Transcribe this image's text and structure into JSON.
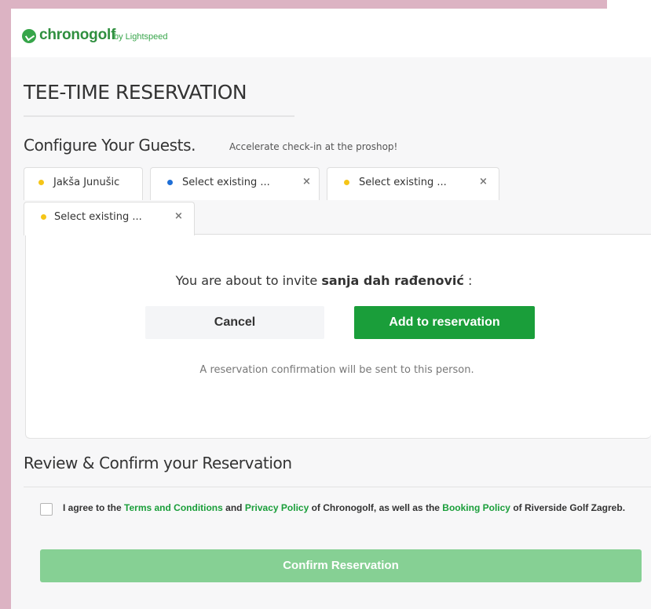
{
  "brand": {
    "name": "chronogolf",
    "by": "by Lightspeed",
    "color": "#37a54a"
  },
  "page": {
    "title": "TEE-TIME RESERVATION"
  },
  "guests": {
    "title": "Configure Your Guests.",
    "subtitle": "Accelerate check-in at the proshop!",
    "tabs": [
      {
        "label": "Jakša Junušic",
        "dot_color": "#f5c518",
        "closable": false
      },
      {
        "label": "Select existing ...",
        "dot_color": "#1f6fd6",
        "closable": true
      },
      {
        "label": "Select existing ...",
        "dot_color": "#f5c518",
        "closable": true
      },
      {
        "label": "Select existing ...",
        "dot_color": "#f5c518",
        "closable": true
      }
    ],
    "close_icon": "×"
  },
  "invite": {
    "prefix": "You are about to invite",
    "name": "sanja dah rađenović",
    "suffix": ":",
    "cancel_label": "Cancel",
    "add_label": "Add to reservation",
    "note": "A reservation confirmation will be sent to this person."
  },
  "review": {
    "title": "Review & Confirm your Reservation",
    "agree_prefix": "I agree to the",
    "terms_link": "Terms and Conditions",
    "and": "and",
    "privacy_link": "Privacy Policy",
    "of_chronogolf": "of Chronogolf, as well as the",
    "booking_link": "Booking Policy",
    "of_course": "of Riverside Golf Zagreb.",
    "confirm_label": "Confirm Reservation"
  },
  "colors": {
    "accent_green": "#1a9e3a",
    "confirm_disabled": "#86d094",
    "frame": "#dcb3c3"
  }
}
